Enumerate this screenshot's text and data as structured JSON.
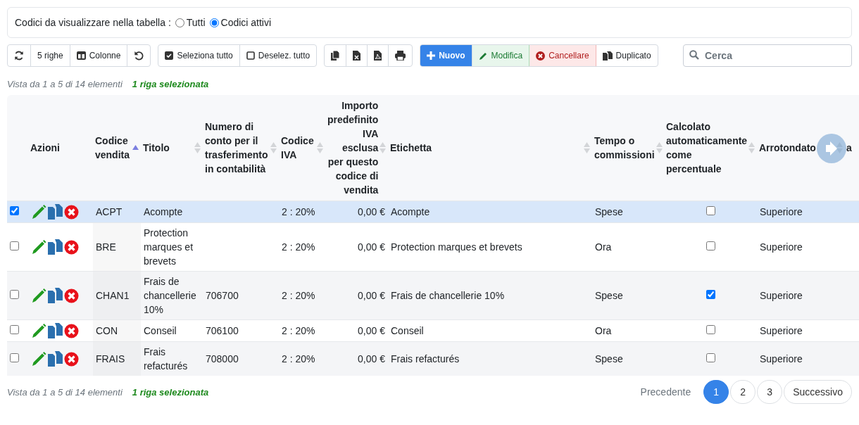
{
  "filter": {
    "label": "Codici da visualizzare nella tabella :",
    "options": [
      {
        "label": "Tutti",
        "selected": false
      },
      {
        "label": "Codici attivi",
        "selected": true
      }
    ]
  },
  "toolbar": {
    "view_buttons": [
      {
        "kind": "refresh"
      },
      {
        "kind": "text",
        "label": "5 righe"
      },
      {
        "kind": "columns",
        "label": "Colonne"
      },
      {
        "kind": "reset"
      }
    ],
    "selection_buttons": [
      {
        "label": "Seleziona tutto",
        "checked": true
      },
      {
        "label": "Deselez. tutto",
        "checked": false
      }
    ],
    "export_buttons": [
      {
        "kind": "copy"
      },
      {
        "kind": "excel"
      },
      {
        "kind": "pdf"
      },
      {
        "kind": "print"
      }
    ],
    "action_buttons": [
      {
        "kind": "primary",
        "label": "Nuovo"
      },
      {
        "kind": "edit",
        "label": "Modifica"
      },
      {
        "kind": "delete",
        "label": "Cancellare"
      },
      {
        "kind": "duplicate",
        "label": "Duplicato"
      }
    ]
  },
  "search": {
    "placeholder": "Cerca"
  },
  "info_top": {
    "range": "Vista da 1 a 5 di 14 elementi",
    "selection": "1 riga selezionata"
  },
  "table": {
    "actions_column": {
      "label": "Azioni"
    },
    "columns": [
      {
        "label": "Codice vendita",
        "kind": "code",
        "sortable": true,
        "sorted": true
      },
      {
        "label": "Titolo",
        "kind": "text",
        "sortable": true,
        "sorted": false
      },
      {
        "label": "Numero di conto per il trasferimento in contabilità",
        "kind": "text",
        "sortable": true,
        "sorted": false
      },
      {
        "label": "Codice IVA",
        "kind": "text",
        "sortable": true,
        "sorted": false
      },
      {
        "label": "Importo predefinito IVA esclusa per questo codice di vendita",
        "kind": "amount",
        "sortable": true,
        "sorted": false
      },
      {
        "label": "Etichetta",
        "kind": "text",
        "sortable": true,
        "sorted": false
      },
      {
        "label": "Tempo o commissioni",
        "kind": "text",
        "sortable": true,
        "sorted": false
      },
      {
        "label": "Calcolato automaticamente come percentuale",
        "kind": "check",
        "sortable": true,
        "sorted": false
      },
      {
        "label": "Arrotondato",
        "kind": "text",
        "sortable": true,
        "sorted": false
      },
      {
        "label": "a",
        "kind": "text",
        "sortable": false
      }
    ],
    "rows": [
      {
        "selected": true,
        "cells": [
          "ACPT",
          "Acompte",
          null,
          "2 : 20%",
          "0,00 €",
          "Acompte",
          "Spese",
          {
            "checked": false
          },
          "Superiore"
        ]
      },
      {
        "selected": false,
        "cells": [
          "BRE",
          "Protection marques et brevets",
          null,
          "2 : 20%",
          "0,00 €",
          "Protection marques et brevets",
          "Ora",
          {
            "checked": false
          },
          "Superiore"
        ]
      },
      {
        "selected": false,
        "cells": [
          "CHAN1",
          "Frais de chancellerie 10%",
          "706700",
          "2 : 20%",
          "0,00 €",
          "Frais de chancellerie 10%",
          "Spese",
          {
            "checked": true
          },
          "Superiore"
        ]
      },
      {
        "selected": false,
        "cells": [
          "CON",
          "Conseil",
          "706100",
          "2 : 20%",
          "0,00 €",
          "Conseil",
          "Ora",
          {
            "checked": false
          },
          "Superiore"
        ]
      },
      {
        "selected": false,
        "cells": [
          "FRAIS",
          "Frais refacturés",
          "708000",
          "2 : 20%",
          "0,00 €",
          "Frais refacturés",
          "Spese",
          {
            "checked": false
          },
          "Superiore"
        ]
      }
    ]
  },
  "info_bottom": {
    "range": "Vista da 1 a 5 di 14 elementi",
    "selection": "1 riga selezionata"
  },
  "pagination": {
    "previous": "Precedente",
    "pages": [
      {
        "label": "1",
        "selected": true
      },
      {
        "label": "2",
        "selected": false
      },
      {
        "label": "3",
        "selected": false
      }
    ],
    "next": "Successivo"
  }
}
